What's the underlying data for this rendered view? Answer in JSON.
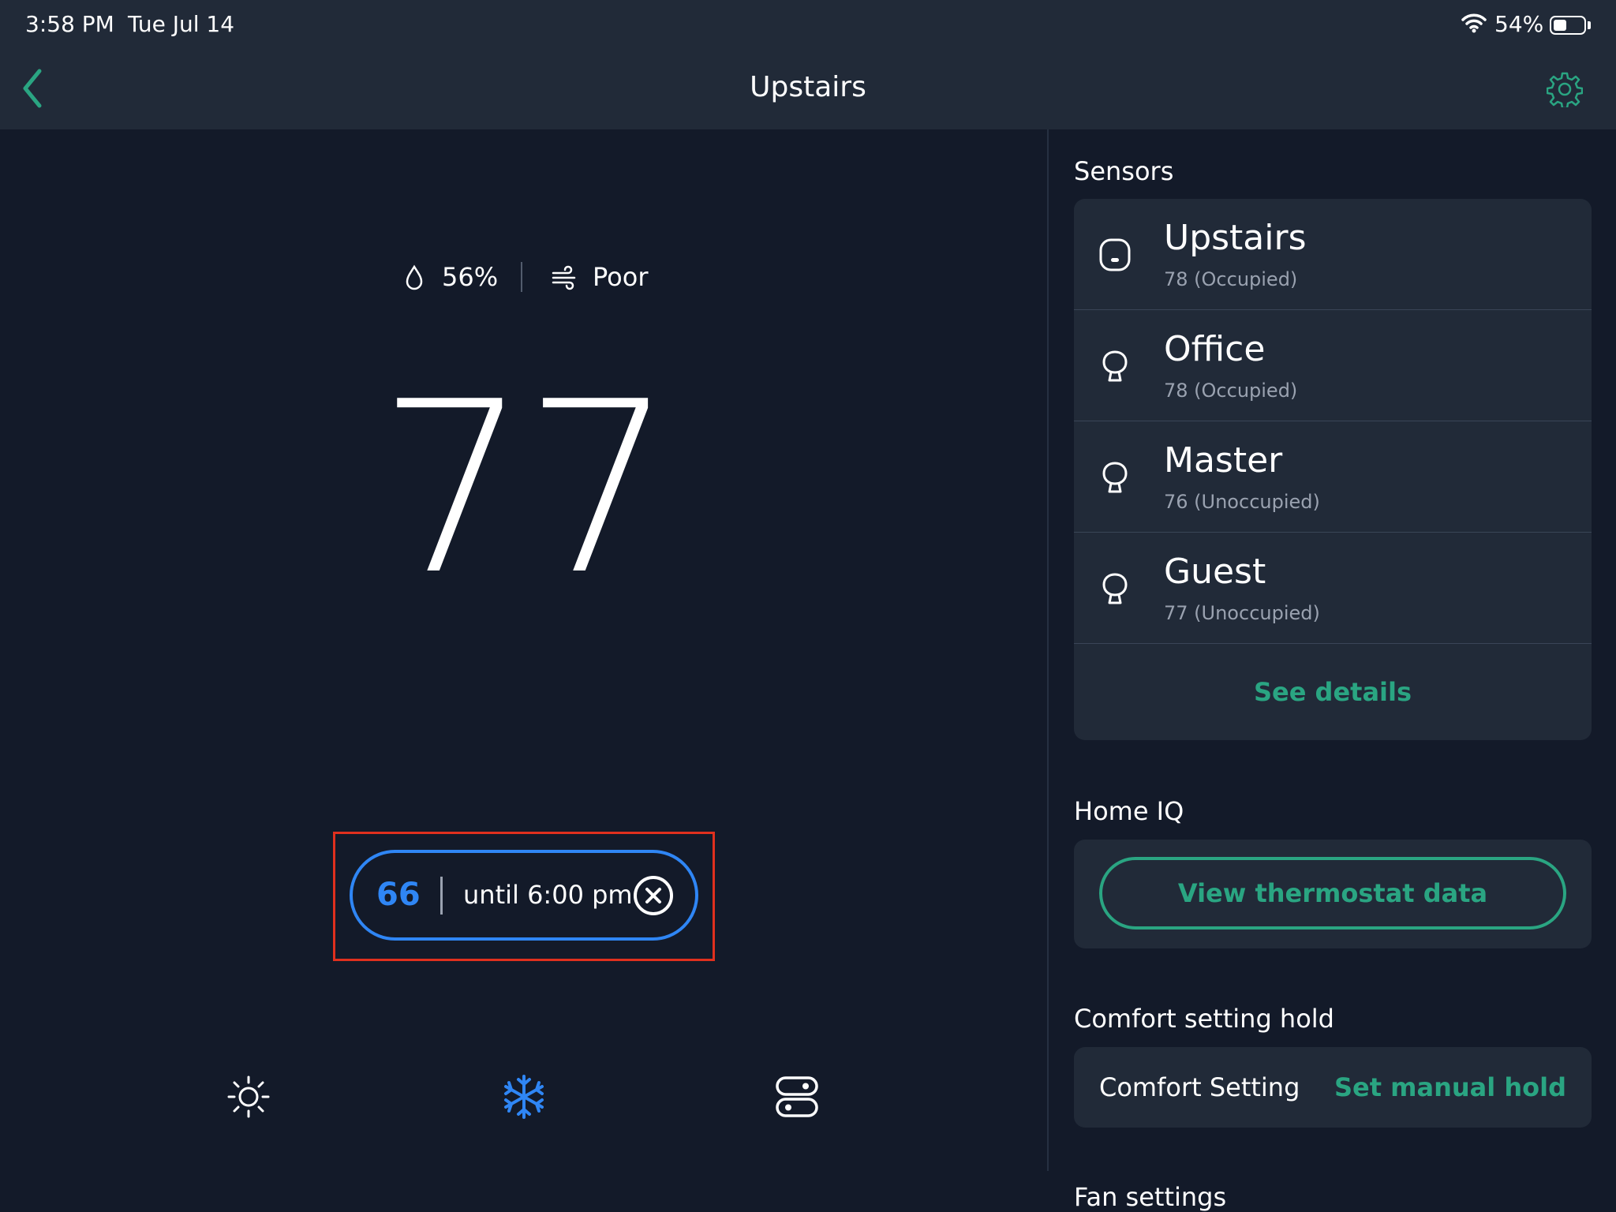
{
  "status_bar": {
    "time": "3:58 PM",
    "date": "Tue Jul 14",
    "battery_percent": "54%",
    "battery_level": 0.45
  },
  "nav": {
    "title": "Upstairs",
    "back_icon": "chevron-left-icon",
    "settings_icon": "gear-icon"
  },
  "thermostat": {
    "humidity": "56%",
    "air_quality": "Poor",
    "current_temp": "77",
    "hold": {
      "setpoint": "66",
      "until": "until 6:00 pm"
    },
    "modes": [
      {
        "name": "heat",
        "icon": "sun-icon"
      },
      {
        "name": "cool",
        "icon": "snowflake-icon",
        "active": true
      },
      {
        "name": "auto",
        "icon": "toggle-icon"
      }
    ]
  },
  "sidebar": {
    "sensors_title": "Sensors",
    "sensors": [
      {
        "name": "Upstairs",
        "status": "78 (Occupied)"
      },
      {
        "name": "Office",
        "status": "78 (Occupied)"
      },
      {
        "name": "Master",
        "status": "76 (Unoccupied)"
      },
      {
        "name": "Guest",
        "status": "77 (Unoccupied)"
      }
    ],
    "see_details": "See details",
    "home_iq_title": "Home IQ",
    "view_data_button": "View thermostat data",
    "comfort_title": "Comfort setting hold",
    "comfort_label": "Comfort Setting",
    "comfort_action": "Set manual hold",
    "fan_title": "Fan settings"
  },
  "colors": {
    "background": "#131a29",
    "panel": "#212a38",
    "accent_green": "#2aa582",
    "accent_blue": "#2f86f5",
    "highlight_red": "#e0301e"
  }
}
